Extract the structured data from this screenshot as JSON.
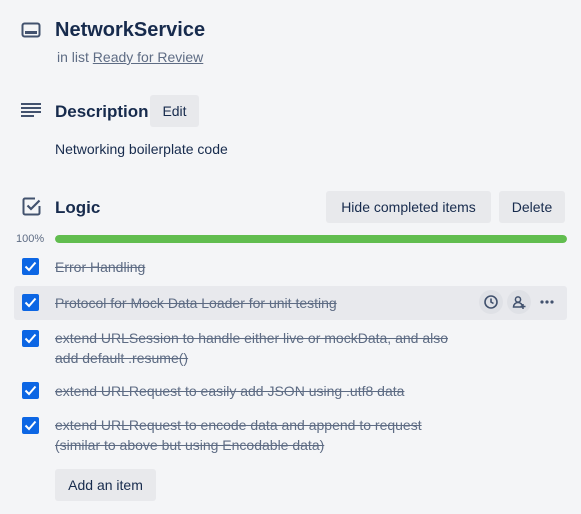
{
  "card": {
    "title": "NetworkService",
    "in_list_prefix": "in list",
    "list_name": "Ready for Review"
  },
  "description": {
    "heading": "Description",
    "edit_label": "Edit",
    "text": "Networking boilerplate code"
  },
  "checklist": {
    "title": "Logic",
    "hide_completed_label": "Hide completed items",
    "delete_label": "Delete",
    "progress_percent": "100%",
    "progress_value": 1.0,
    "items": [
      {
        "text": "Error Handling",
        "checked": true
      },
      {
        "text": "Protocol for Mock Data Loader for unit testing",
        "checked": true
      },
      {
        "line1": "extend URLSession to handle either live or mockData, and also",
        "line2": "add default .resume()",
        "checked": true
      },
      {
        "text": "extend URLRequest to easily add JSON using .utf8 data",
        "checked": true
      },
      {
        "line1": "extend URLRequest to encode data and append to request",
        "line2": "(similar to above but using Encodable data)",
        "checked": true
      }
    ],
    "add_item_label": "Add an item"
  },
  "colors": {
    "accent": "#0c66e4",
    "progress": "#61bd4f",
    "background": "#f4f5f7"
  },
  "icons": [
    "card-icon",
    "description-icon",
    "checklist-icon",
    "check-icon",
    "clock-icon",
    "assign-member-icon",
    "more-icon"
  ]
}
